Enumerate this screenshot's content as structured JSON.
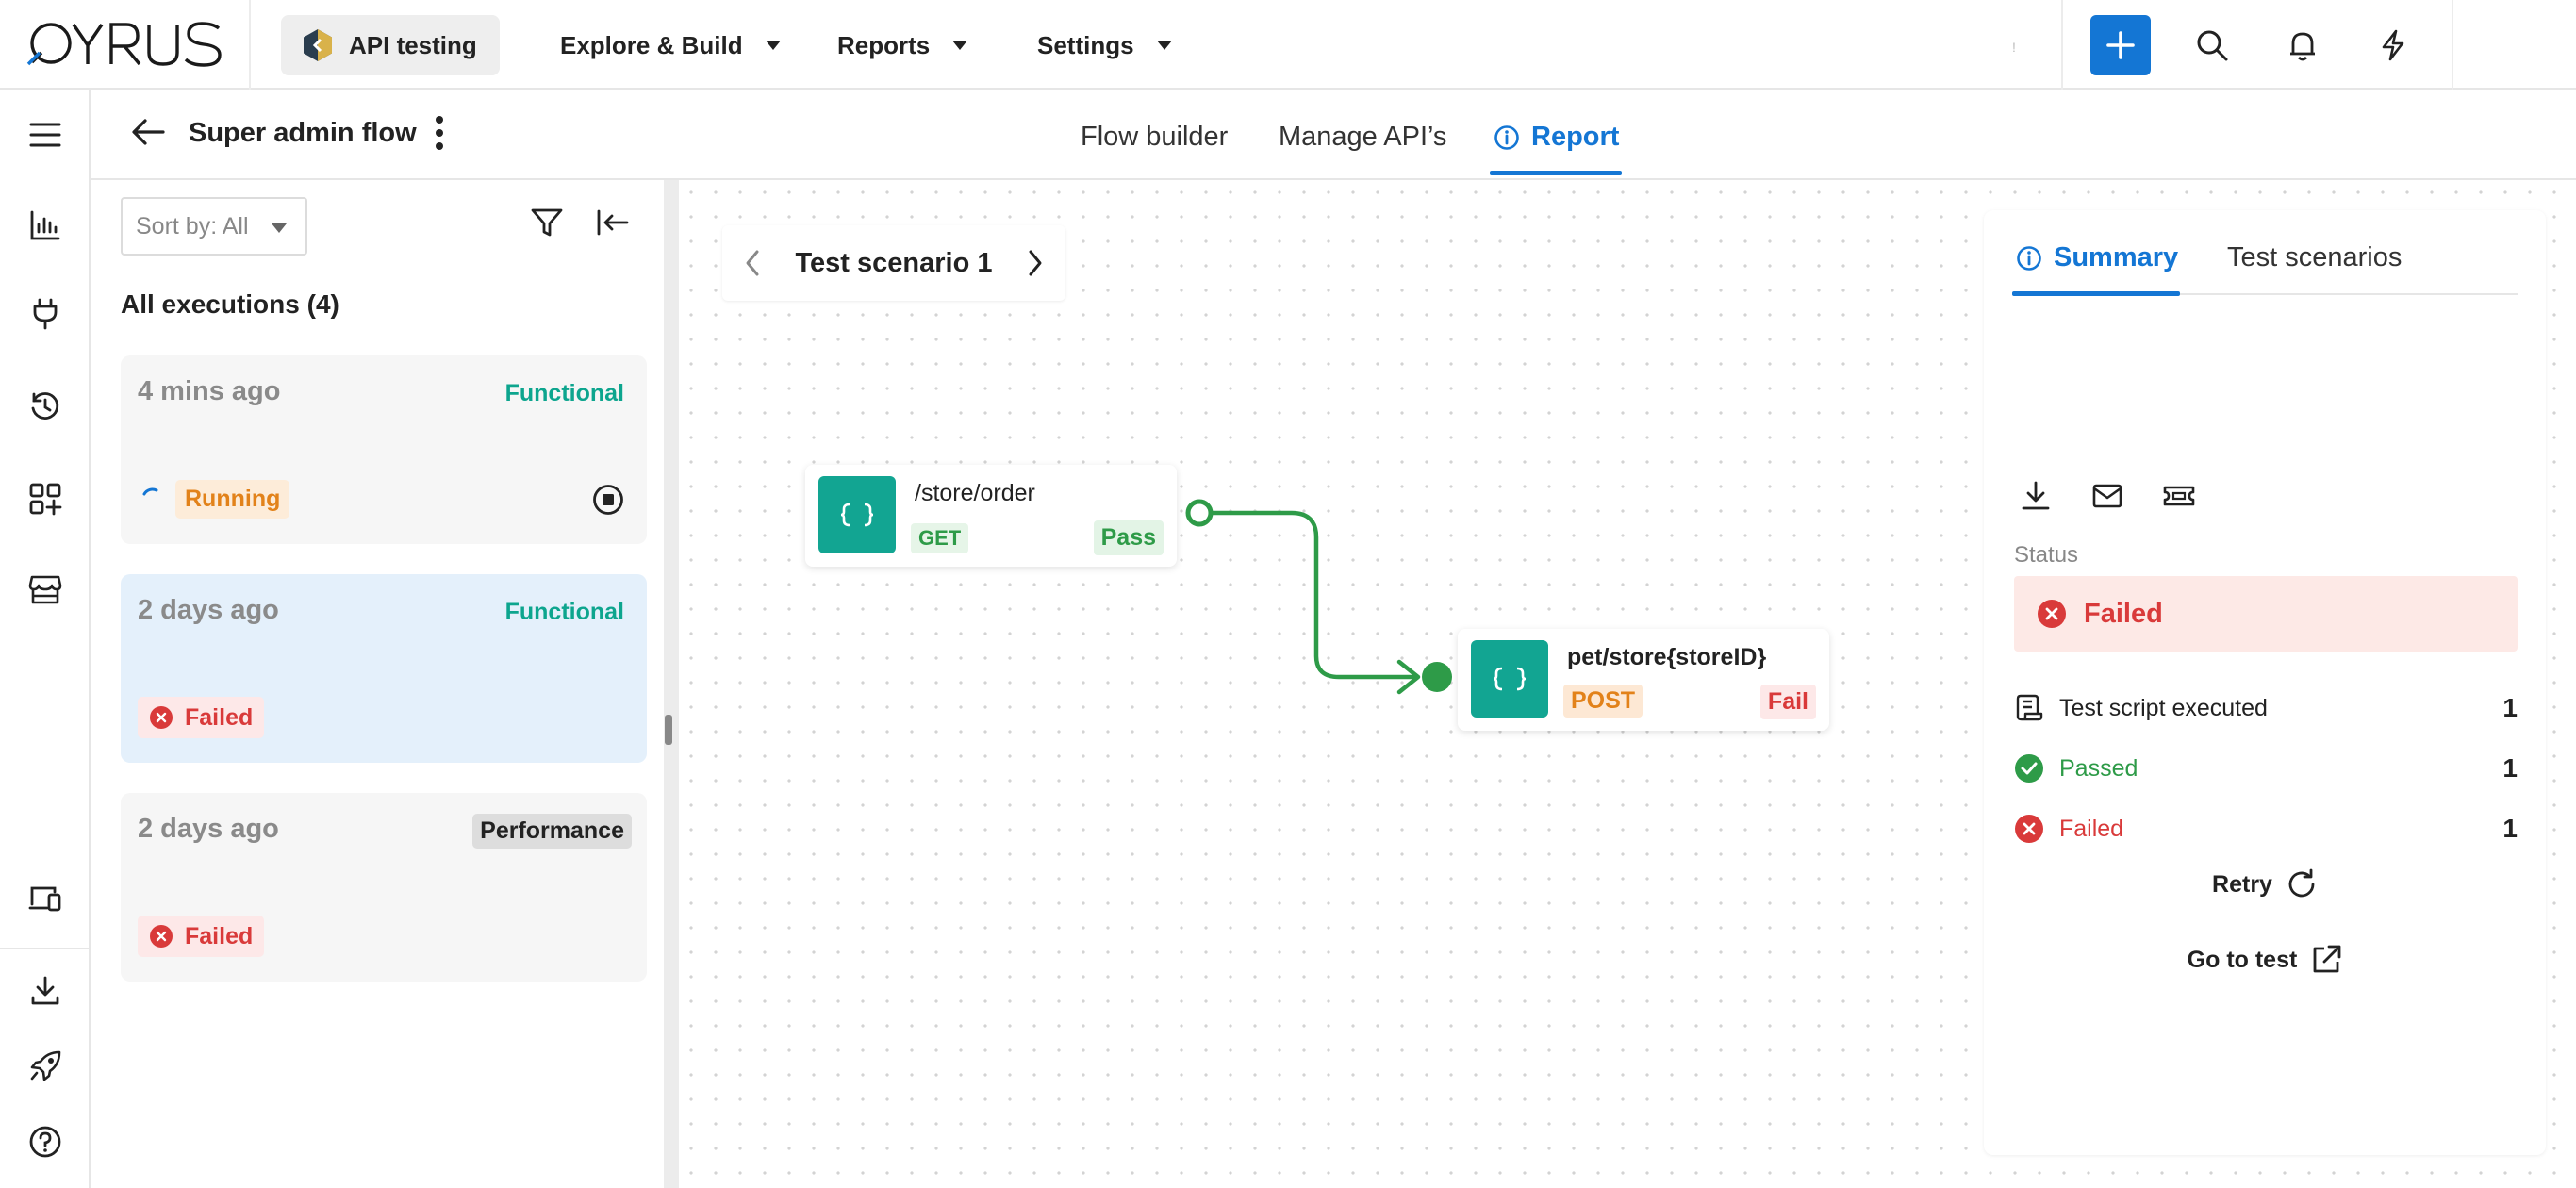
{
  "topbar": {
    "logo_text": "QYRUS",
    "product": "API testing",
    "nav": [
      {
        "label": "Explore & Build"
      },
      {
        "label": "Reports"
      },
      {
        "label": "Settings"
      }
    ],
    "faint_text": "!",
    "accent_color": "#1476d4"
  },
  "rail": {
    "icons": [
      "menu-icon",
      "dashboard-chart-icon",
      "plug-icon",
      "history-icon",
      "apps-add-icon",
      "store-icon",
      "devices-icon",
      "download-icon",
      "rocket-icon",
      "help-icon"
    ]
  },
  "subheader": {
    "title": "Super admin flow",
    "tabs": [
      {
        "label": "Flow builder"
      },
      {
        "label": "Manage API’s"
      },
      {
        "label": "Report"
      }
    ],
    "active_tab": "Report"
  },
  "left_panel": {
    "sort_label": "Sort by: All",
    "heading": "All executions (4)",
    "executions": [
      {
        "time": "4 mins ago",
        "type": "Functional",
        "status": "Running"
      },
      {
        "time": "2 days ago",
        "type": "Functional",
        "status": "Failed"
      },
      {
        "time": "2 days ago",
        "type": "Performance",
        "status": "Failed"
      }
    ]
  },
  "canvas": {
    "scenario": "Test scenario 1",
    "nodes": [
      {
        "path": "/store/order",
        "method": "GET",
        "result": "Pass"
      },
      {
        "path": "pet/store{storeID}",
        "method": "POST",
        "result": "Fail"
      }
    ],
    "node_icon_glyph": "{ }"
  },
  "summary": {
    "tabs": [
      "Summary",
      "Test scenarios"
    ],
    "status_label": "Status",
    "status_value": "Failed",
    "stats": [
      {
        "label": "Test script executed",
        "count": "1"
      },
      {
        "label": "Passed",
        "count": "1"
      },
      {
        "label": "Failed",
        "count": "1"
      }
    ],
    "retry_label": "Retry",
    "goto_label": "Go to test"
  },
  "colors": {
    "pass_green": "#2e9b48",
    "fail_red": "#d93a3a",
    "node_teal": "#12a592",
    "running_orange": "#e2821a"
  }
}
